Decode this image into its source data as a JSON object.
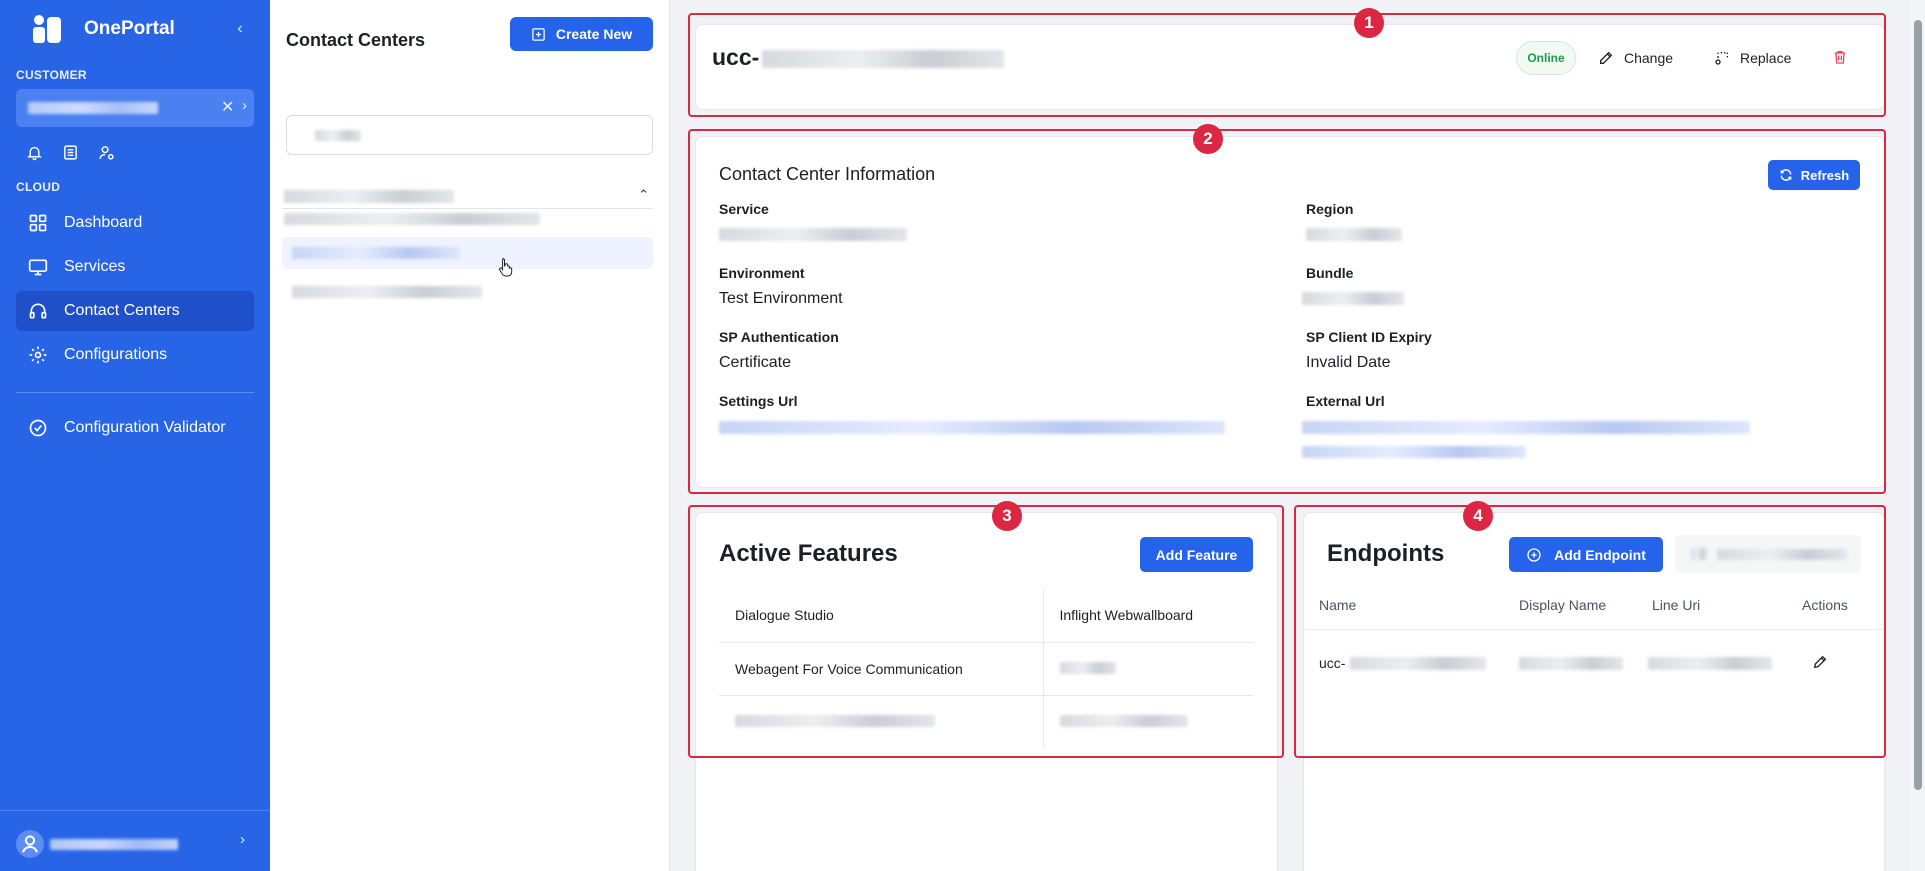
{
  "sidebar": {
    "brand": "OnePortal",
    "customer_section": "CUSTOMER",
    "cloud_section": "CLOUD",
    "nav": [
      {
        "label": "Dashboard",
        "icon": "grid-icon"
      },
      {
        "label": "Services",
        "icon": "monitor-icon"
      },
      {
        "label": "Contact Centers",
        "icon": "headset-icon",
        "active": true
      },
      {
        "label": "Configurations",
        "icon": "gear-icon"
      }
    ],
    "validator": "Configuration Validator"
  },
  "middle": {
    "title": "Contact Centers",
    "create_label": "Create New"
  },
  "header": {
    "name_prefix": "ucc-",
    "status": "Online",
    "change_label": "Change",
    "replace_label": "Replace"
  },
  "info": {
    "title": "Contact Center Information",
    "refresh_label": "Refresh",
    "service_label": "Service",
    "region_label": "Region",
    "environment_label": "Environment",
    "environment_value": "Test Environment",
    "bundle_label": "Bundle",
    "sp_auth_label": "SP Authentication",
    "sp_auth_value": "Certificate",
    "sp_expiry_label": "SP Client ID Expiry",
    "sp_expiry_value": "Invalid Date",
    "settings_url_label": "Settings Url",
    "external_url_label": "External Url"
  },
  "features": {
    "title": "Active Features",
    "add_label": "Add Feature",
    "rows": [
      [
        "Dialogue Studio",
        "Inflight Webwallboard"
      ],
      [
        "Webagent For Voice Communication",
        ""
      ],
      [
        "",
        ""
      ]
    ]
  },
  "endpoints": {
    "title": "Endpoints",
    "add_label": "Add Endpoint",
    "columns": [
      "Name",
      "Display Name",
      "Line Uri",
      "Actions"
    ],
    "row_name_prefix": "ucc-"
  },
  "annotations": [
    "1",
    "2",
    "3",
    "4"
  ],
  "colors": {
    "sidebar_bg": "#2764e6",
    "primary": "#2563eb",
    "highlight_outline": "#dc2743",
    "online_text": "#1f9a4a"
  }
}
